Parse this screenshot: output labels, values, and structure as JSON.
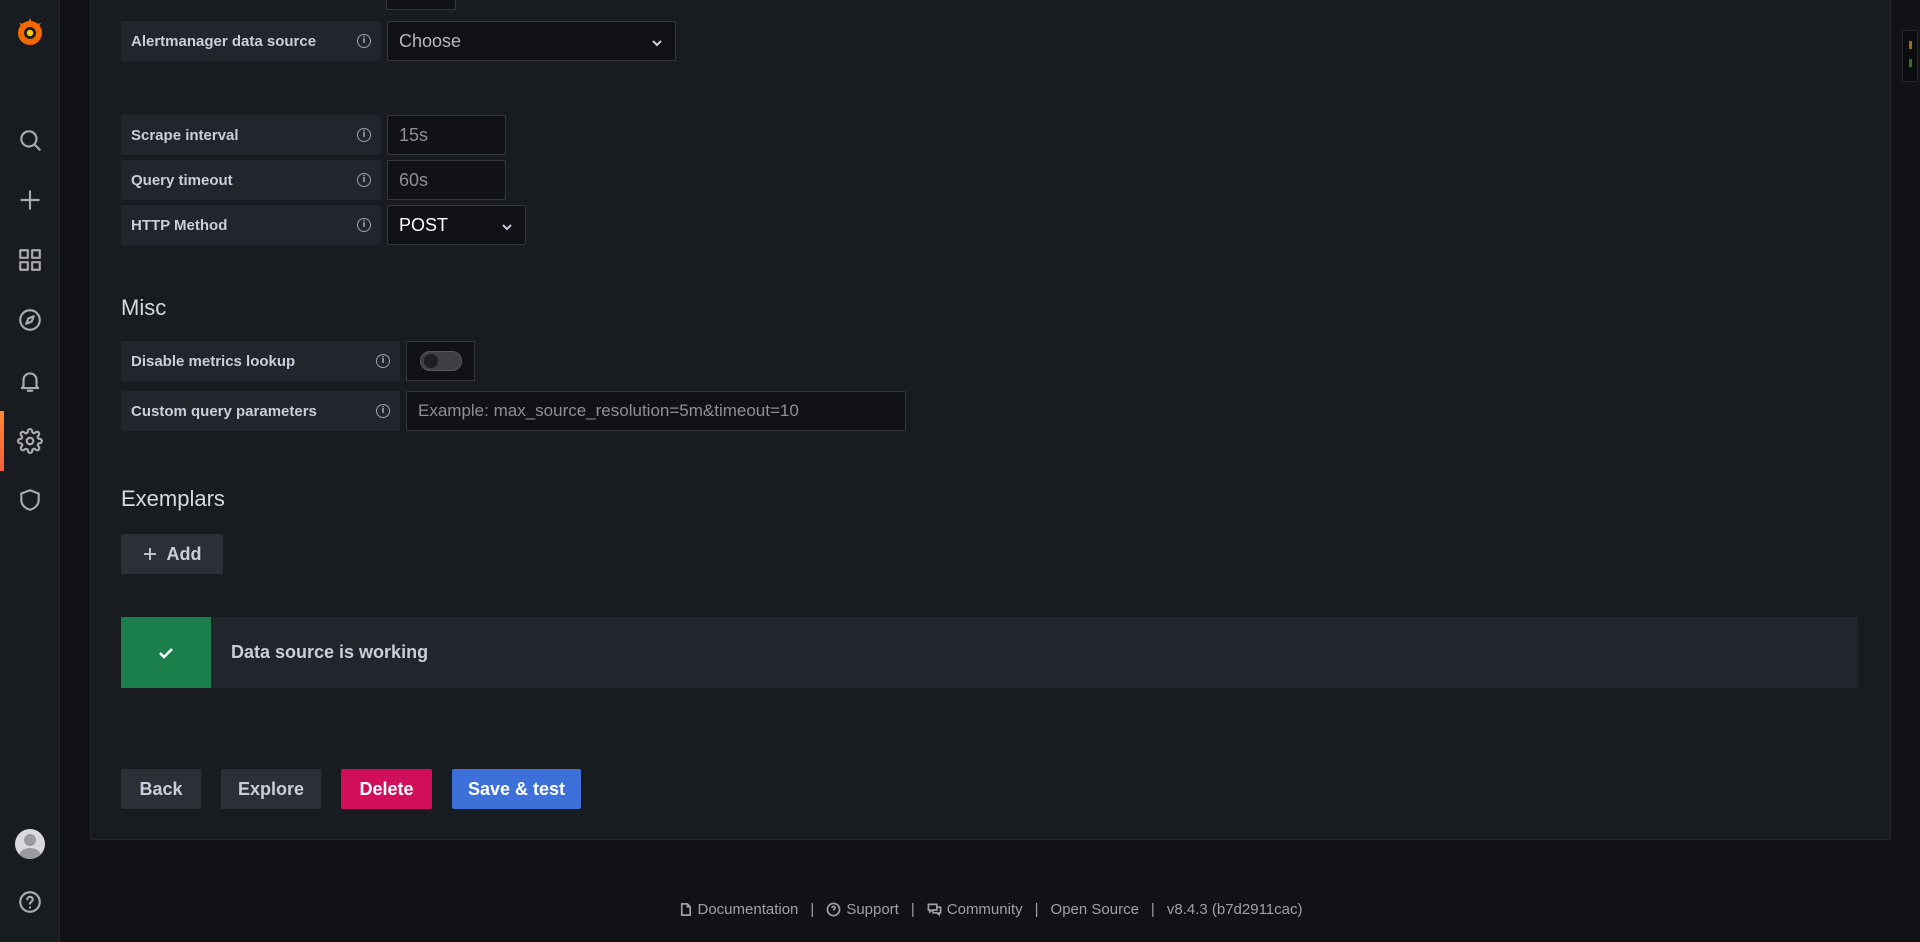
{
  "sidebar": {
    "items": [
      {
        "name": "grafana-logo",
        "icon": "grafana-logo"
      },
      {
        "name": "search",
        "icon": "search-icon"
      },
      {
        "name": "create",
        "icon": "plus-icon"
      },
      {
        "name": "dashboards",
        "icon": "dashboards-icon"
      },
      {
        "name": "explore",
        "icon": "compass-icon"
      },
      {
        "name": "alerting",
        "icon": "bell-icon"
      },
      {
        "name": "configuration",
        "icon": "gear-icon",
        "active": true
      },
      {
        "name": "server-admin",
        "icon": "shield-icon"
      },
      {
        "name": "profile",
        "icon": "avatar"
      },
      {
        "name": "help",
        "icon": "question-icon"
      }
    ]
  },
  "form": {
    "alertmanager": {
      "label": "Alertmanager data source",
      "value": "Choose"
    },
    "scrape_interval": {
      "label": "Scrape interval",
      "placeholder": "15s"
    },
    "query_timeout": {
      "label": "Query timeout",
      "placeholder": "60s"
    },
    "http_method": {
      "label": "HTTP Method",
      "value": "POST"
    }
  },
  "misc": {
    "title": "Misc",
    "disable_metrics_lookup": {
      "label": "Disable metrics lookup",
      "enabled": false
    },
    "custom_query_parameters": {
      "label": "Custom query parameters",
      "placeholder": "Example: max_source_resolution=5m&timeout=10"
    }
  },
  "exemplars": {
    "title": "Exemplars",
    "add_label": "Add"
  },
  "alert": {
    "text": "Data source is working",
    "color": "#1a7f4b"
  },
  "actions": {
    "back": "Back",
    "explore": "Explore",
    "delete": "Delete",
    "save_test": "Save & test"
  },
  "footer": {
    "documentation": "Documentation",
    "support": "Support",
    "community": "Community",
    "open_source": "Open Source",
    "version": "v8.4.3 (b7d2911cac)",
    "separator": "|"
  },
  "colors": {
    "accent": "#ff8833",
    "primary": "#3d71d9",
    "danger": "#d10e5c",
    "success": "#1a7f4b"
  }
}
